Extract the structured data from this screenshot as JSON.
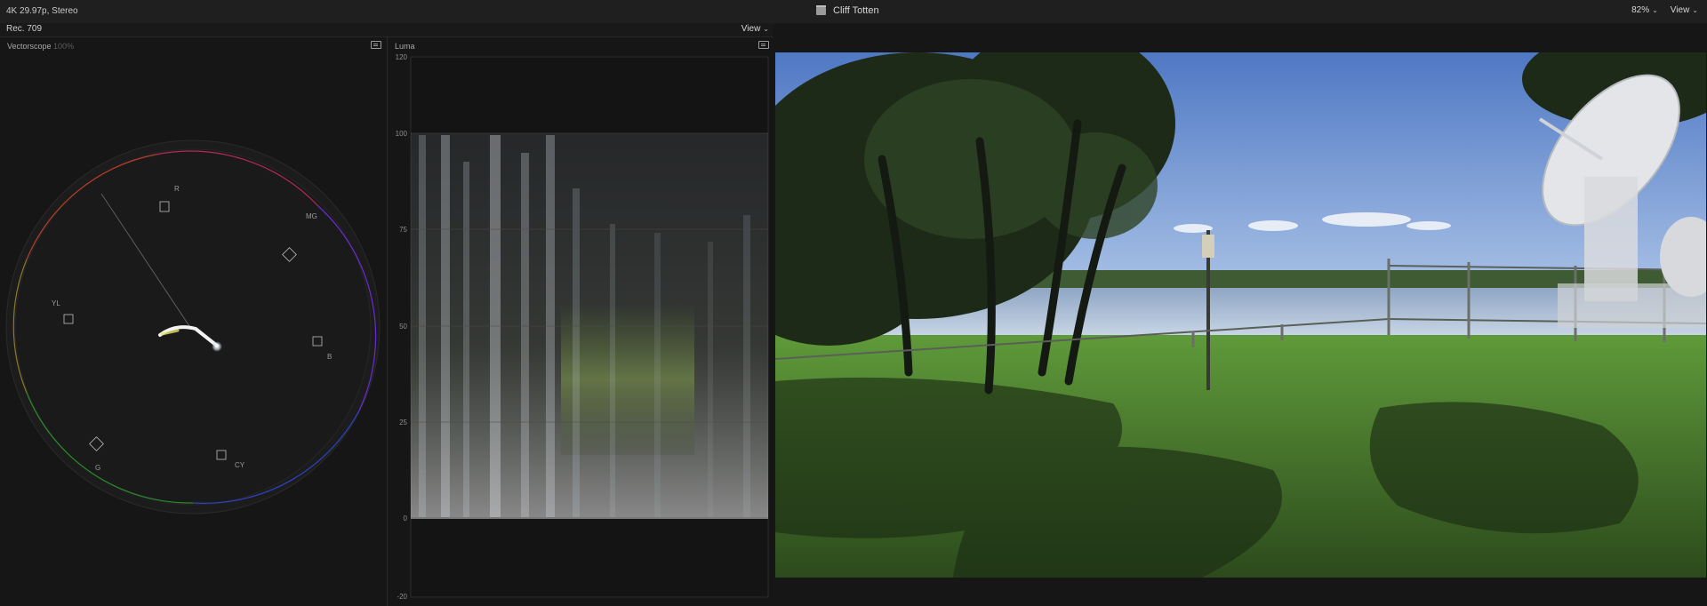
{
  "topbar": {
    "format_info": "4K 29.97p, Stereo",
    "project_title": "Cliff Totten",
    "zoom": "82%",
    "view_label": "View"
  },
  "scopes": {
    "colorspace": "Rec. 709",
    "view_label": "View",
    "vectorscope": {
      "title": "Vectorscope",
      "scale": "100%",
      "targets": [
        "R",
        "MG",
        "YL",
        "B",
        "G",
        "CY"
      ]
    },
    "luma": {
      "title": "Luma",
      "ticks": [
        "120",
        "100",
        "75",
        "50",
        "25",
        "0",
        "-20"
      ]
    }
  },
  "colors": {
    "background": "#161616",
    "topbar": "#1f1f1f",
    "accent_text": "#c8c8c8"
  }
}
